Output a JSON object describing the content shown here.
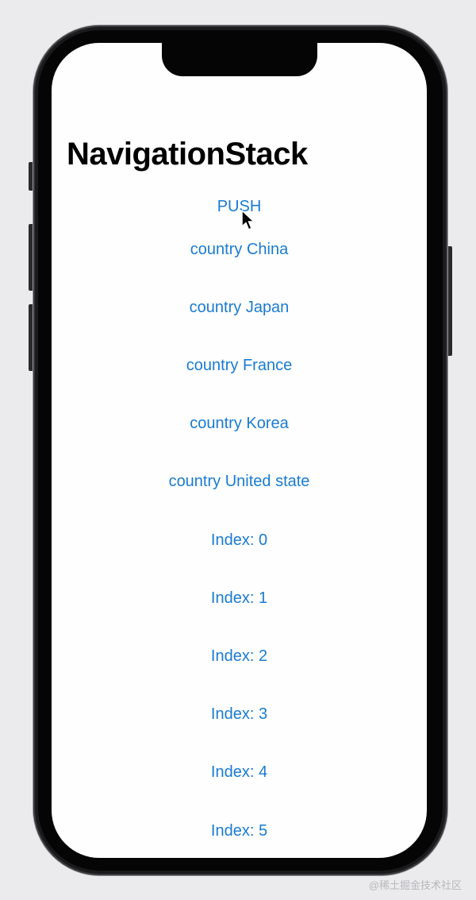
{
  "navigation": {
    "title": "NavigationStack"
  },
  "list": {
    "items": [
      "PUSH",
      "country China",
      "country Japan",
      "country France",
      "country Korea",
      "country United state",
      "Index: 0",
      "Index: 1",
      "Index: 2",
      "Index: 3",
      "Index: 4",
      "Index: 5"
    ]
  },
  "colors": {
    "link": "#1a7bd1",
    "title": "#000000",
    "background": "#fefefe"
  },
  "watermark": "@稀土掘金技术社区"
}
